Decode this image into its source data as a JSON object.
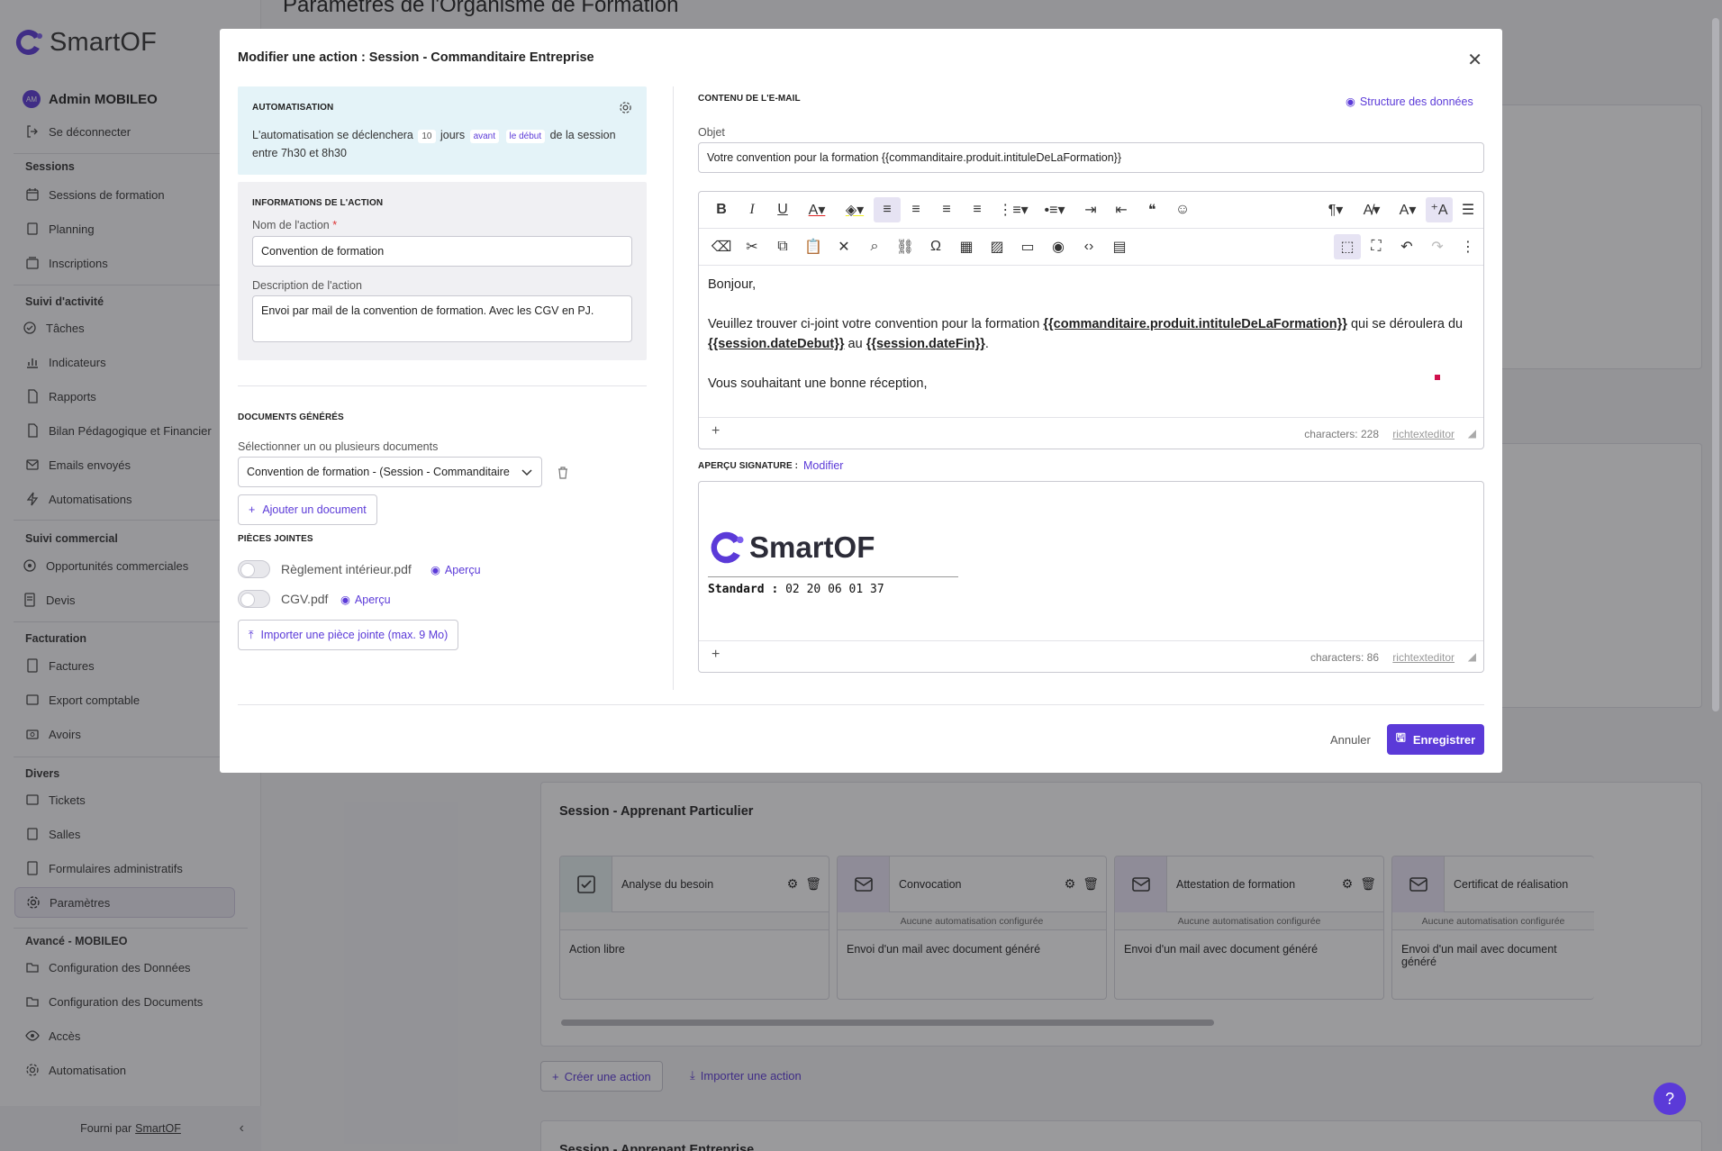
{
  "app": {
    "brand": "SmartOF",
    "accent": "#5b3ad8"
  },
  "user": {
    "initials": "AM",
    "name": "Admin MOBILEO",
    "logout": "Se déconnecter"
  },
  "sidebar": {
    "groups": {
      "sessions": "Sessions",
      "suivi": "Suivi d'activité",
      "commercial": "Suivi commercial",
      "facturation": "Facturation",
      "divers": "Divers",
      "avance": "Avancé - MOBILEO"
    },
    "items": {
      "sessions_formation": "Sessions de formation",
      "planning": "Planning",
      "inscriptions": "Inscriptions",
      "taches": "Tâches",
      "indicateurs": "Indicateurs",
      "rapports": "Rapports",
      "bilan": "Bilan Pédagogique et Financier",
      "emails": "Emails envoyés",
      "automatisations": "Automatisations",
      "opportunites": "Opportunités commerciales",
      "devis": "Devis",
      "factures": "Factures",
      "export": "Export comptable",
      "avoirs": "Avoirs",
      "tickets": "Tickets",
      "salles": "Salles",
      "formulaires": "Formulaires administratifs",
      "parametres": "Paramètres",
      "config_donnees": "Configuration des Données",
      "config_documents": "Configuration des Documents",
      "acces": "Accès",
      "automatisation": "Automatisation"
    },
    "footer_prefix": "Fourni par",
    "footer_link": "SmartOF"
  },
  "main": {
    "page_title": "Paramètres de l'Organisme de Formation",
    "section_particulier": "Session - Apprenant Particulier",
    "section_entreprise": "Session - Apprenant Entreprise",
    "actions": [
      {
        "title": "Analyse du besoin",
        "sub": "",
        "body": "Action libre",
        "icon": "check-square-icon"
      },
      {
        "title": "Convocation",
        "sub": "Aucune automatisation configurée",
        "body": "Envoi d'un mail avec document généré",
        "icon": "mail-icon"
      },
      {
        "title": "Attestation de formation",
        "sub": "Aucune automatisation configurée",
        "body": "Envoi d'un mail avec document généré",
        "icon": "mail-icon"
      },
      {
        "title": "Certificat de réalisation",
        "sub": "Aucune automatisation configurée",
        "body": "Envoi d'un mail avec document généré",
        "icon": "mail-icon"
      }
    ],
    "create_action": "Créer une action",
    "import_action": "Importer une action",
    "help": "?"
  },
  "modal": {
    "title": "Modifier une action : Session - Commanditaire Entreprise",
    "auto_label": "Automatisation",
    "auto_pre": "L'automatisation se déclenchera",
    "auto_days_value": "10",
    "auto_days": "jours",
    "auto_when": "avant",
    "auto_ref": "le début",
    "auto_post": "de la session",
    "auto_window": "entre 7h30 et 8h30",
    "info_label": "Informations de l'action",
    "name_label": "Nom de l'action",
    "required_mark": "*",
    "name_value": "Convention de formation",
    "desc_label": "Description de l'action",
    "desc_value": "Envoi par mail de la convention de formation. Avec les CGV en PJ.",
    "docs_label": "Documents générés",
    "docs_select_label": "Sélectionner un ou plusieurs documents",
    "docs_selected": "Convention de formation - (Session - Commanditaire",
    "add_document": "Ajouter un document",
    "attachments_label": "Pièces jointes",
    "attachments": [
      {
        "name": "Règlement intérieur.pdf",
        "preview": "Aperçu"
      },
      {
        "name": "CGV.pdf",
        "preview": "Aperçu"
      }
    ],
    "import_attachment": "Importer une pièce jointe (max. 9 Mo)",
    "email_label": "Contenu de l'e-mail",
    "data_structure": "Structure des données",
    "subject_label": "Objet",
    "subject_value": "Votre convention pour la formation {{commanditaire.produit.intituleDeLaFormation}}",
    "body": {
      "greeting": "Bonjour,",
      "line1_pre": "Veuillez trouver ci-joint votre convention pour la formation",
      "var_formation": "{{commanditaire.produit.intituleDeLaFormation}}",
      "line1_post": "qui se déroulera du",
      "var_debut": "{{session.dateDebut}}",
      "au": "au",
      "var_fin": "{{session.dateFin}}",
      "dot": ".",
      "closing": "Vous souhaitant une bonne réception,"
    },
    "body_chars": "characters: 228",
    "editor_brand": "richtexteditor",
    "sig_label": "Aperçu signature :",
    "sig_modify": "Modifier",
    "sig_brand": "SmartOF",
    "sig_phone_label": "Standard :",
    "sig_phone": "02 20 06 01 37",
    "sig_chars": "characters: 86",
    "cancel": "Annuler",
    "save": "Enregistrer"
  }
}
